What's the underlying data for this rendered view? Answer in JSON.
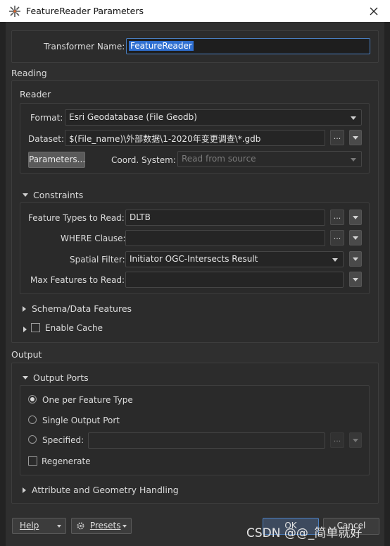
{
  "window": {
    "title": "FeatureReader Parameters",
    "close": "✕"
  },
  "transformer": {
    "label": "Transformer Name:",
    "value": "FeatureReader"
  },
  "reading": {
    "section": "Reading",
    "reader": {
      "section": "Reader",
      "format_label": "Format:",
      "format_value": "Esri Geodatabase (File Geodb)",
      "dataset_label": "Dataset:",
      "dataset_value": "$(File_name)\\外部数据\\1-2020年变更调查\\*.gdb",
      "parameters_button": "Parameters...",
      "coord_label": "Coord. System:",
      "coord_value": "Read from source"
    },
    "constraints": {
      "section": "Constraints",
      "feature_types_label": "Feature Types to Read:",
      "feature_types_value": "DLTB",
      "where_label": "WHERE Clause:",
      "where_value": "",
      "spatial_label": "Spatial Filter:",
      "spatial_value": "Initiator OGC-Intersects Result",
      "max_label": "Max Features to Read:",
      "max_value": ""
    },
    "schema_section": "Schema/Data Features",
    "cache_label": "Enable Cache"
  },
  "output": {
    "section": "Output",
    "ports_section": "Output Ports",
    "opt_one": "One per Feature Type",
    "opt_single": "Single Output Port",
    "opt_specified": "Specified:",
    "specified_value": "",
    "regenerate": "Regenerate",
    "attr_section": "Attribute and Geometry Handling"
  },
  "footer": {
    "help": "Help",
    "presets": "Presets",
    "ok": "OK",
    "cancel": "Cancel",
    "watermark": "CSDN @@_简单就好"
  },
  "dots": "...",
  "colors": {
    "accent": "#4a7fc1",
    "selection": "#2f6fd1",
    "background": "#2f2f2f"
  },
  "icons": [
    "feature-reader-icon",
    "close-icon",
    "chevron-down-icon",
    "chevron-right-icon",
    "gear-icon"
  ]
}
